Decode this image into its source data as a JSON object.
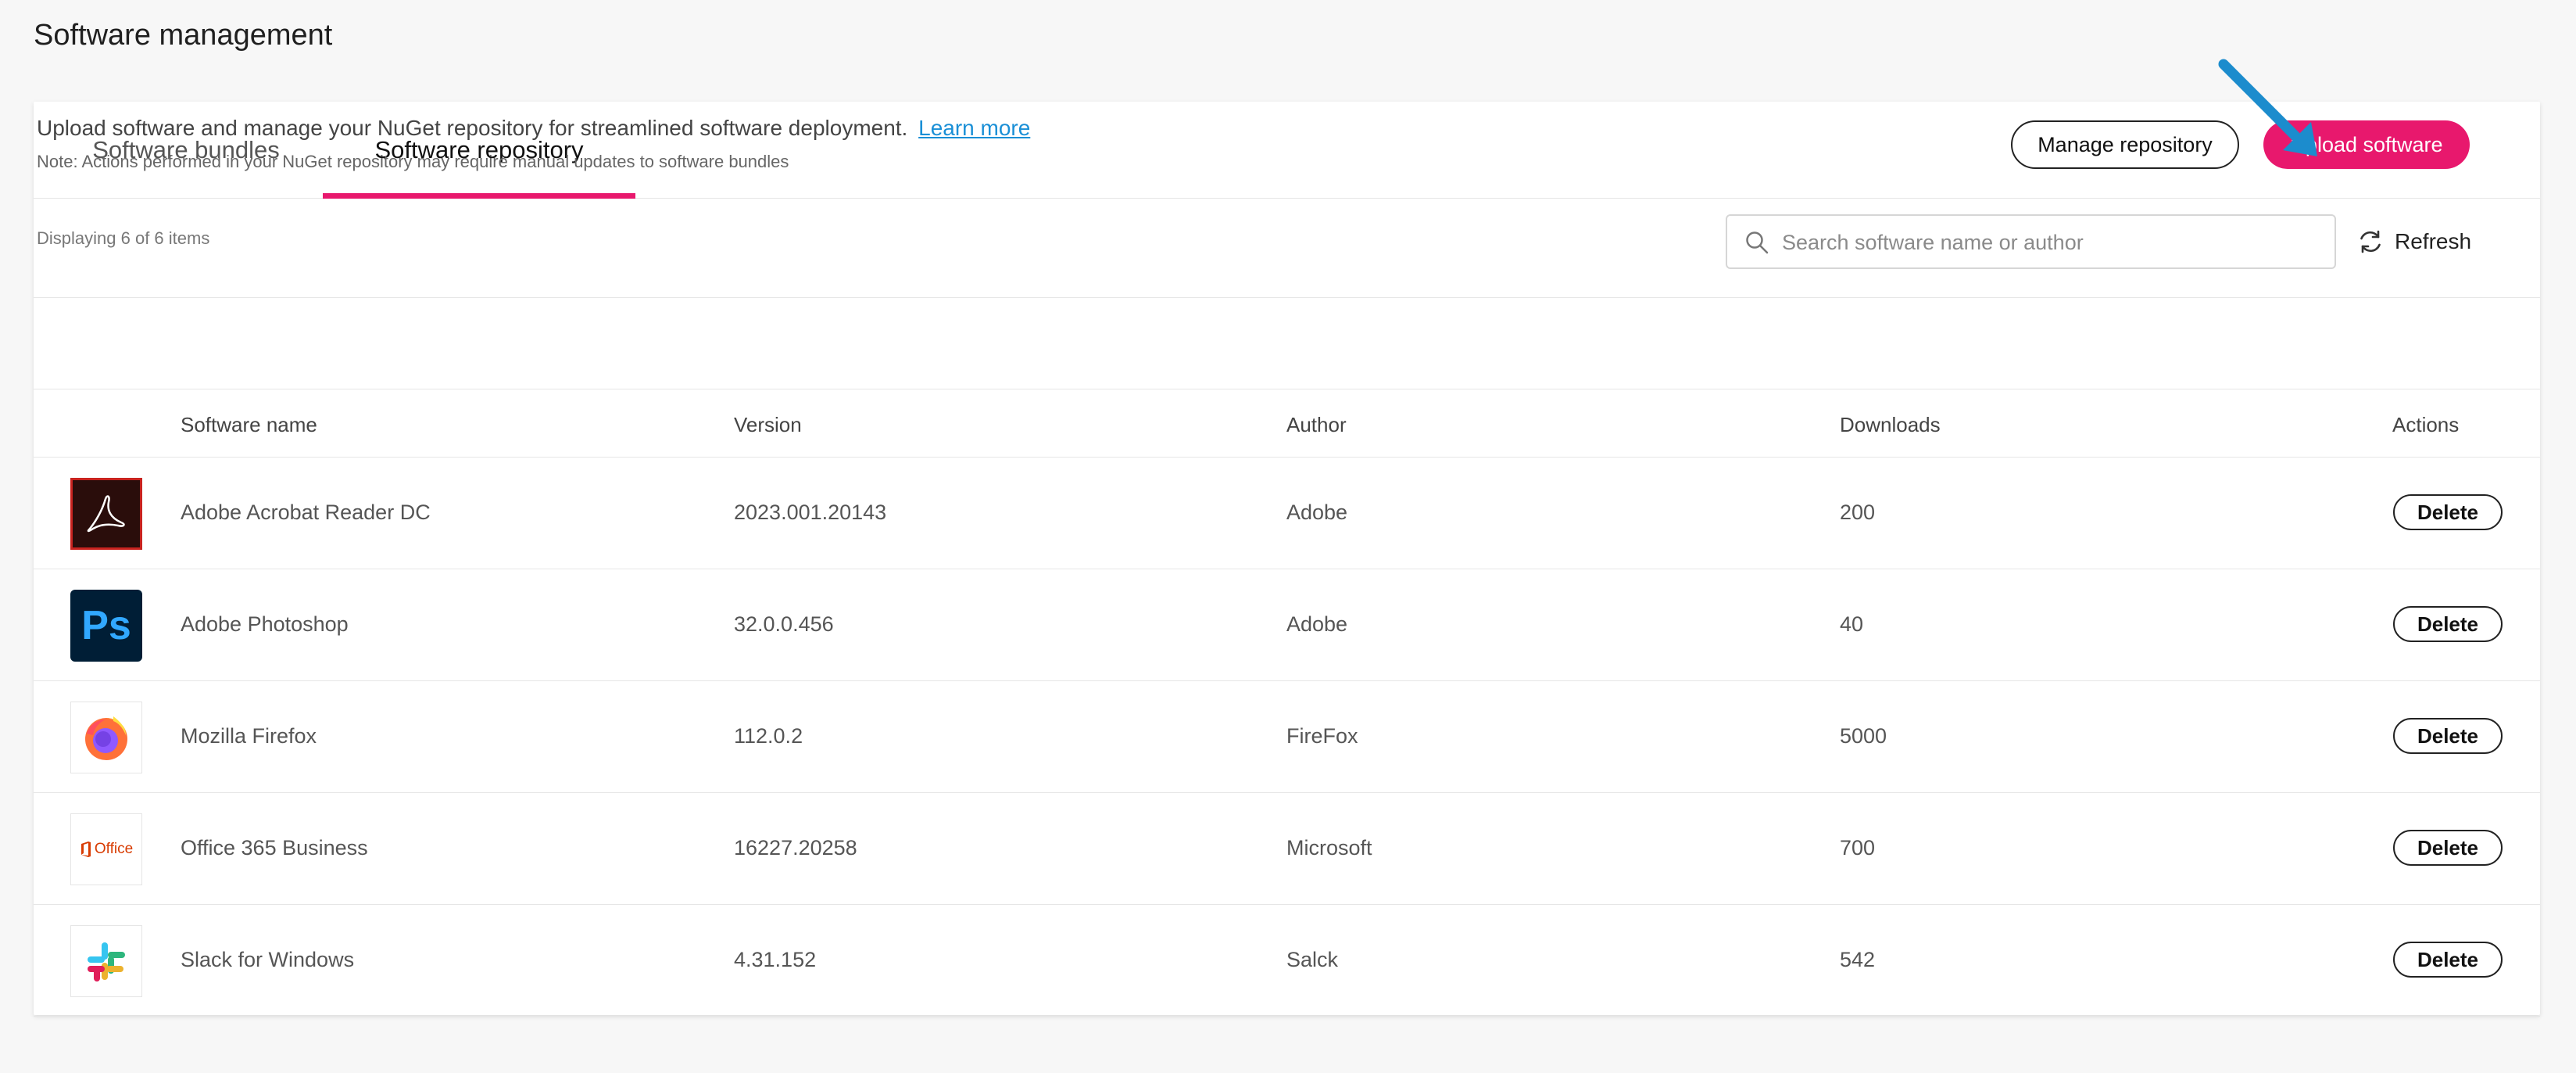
{
  "page": {
    "title": "Software management"
  },
  "tabs": [
    {
      "label": "Software bundles",
      "active": false
    },
    {
      "label": "Software repository",
      "active": true
    }
  ],
  "info": {
    "description": "Upload software and manage your NuGet repository for streamlined software deployment.",
    "learn_more": "Learn more",
    "note": "Note: Actions performed in your NuGet repository may require manual updates to software bundles"
  },
  "actions": {
    "manage_label": "Manage repository",
    "upload_label": "Upload software"
  },
  "toolbar": {
    "displaying": "Displaying 6 of 6 items",
    "search_placeholder": "Search software name or author",
    "refresh_label": "Refresh"
  },
  "table": {
    "headers": {
      "name": "Software name",
      "version": "Version",
      "author": "Author",
      "downloads": "Downloads",
      "actions": "Actions"
    },
    "rows": [
      {
        "icon": "adobe-acrobat-icon",
        "name": "Adobe Acrobat Reader DC",
        "version": "2023.001.20143",
        "author": "Adobe",
        "downloads": "200",
        "action": "Delete"
      },
      {
        "icon": "adobe-photoshop-icon",
        "name": "Adobe Photoshop",
        "version": "32.0.0.456",
        "author": "Adobe",
        "downloads": "40",
        "action": "Delete",
        "logo_text": "Ps"
      },
      {
        "icon": "firefox-icon",
        "name": "Mozilla Firefox",
        "version": "112.0.2",
        "author": "FireFox",
        "downloads": "5000",
        "action": "Delete"
      },
      {
        "icon": "office-icon",
        "name": "Office 365 Business",
        "version": "16227.20258",
        "author": "Microsoft",
        "downloads": "700",
        "action": "Delete",
        "logo_text": "Office"
      },
      {
        "icon": "slack-icon",
        "name": "Slack for Windows",
        "version": "4.31.152",
        "author": "Salck",
        "downloads": "542",
        "action": "Delete"
      }
    ]
  },
  "colors": {
    "accent": "#e8186d",
    "link": "#1a8fd6",
    "annotation_arrow": "#1c8ccd"
  }
}
